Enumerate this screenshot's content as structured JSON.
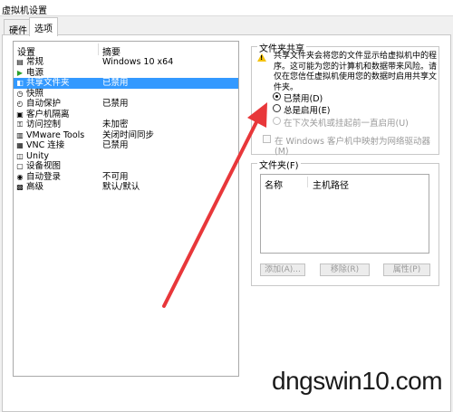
{
  "window": {
    "title": "虚拟机设置"
  },
  "tabs": [
    {
      "label": "硬件"
    },
    {
      "label": "选项"
    }
  ],
  "settings": {
    "col_setting": "设置",
    "col_summary": "摘要",
    "rows": [
      {
        "icon": "general-icon",
        "name": "常规",
        "summary": "Windows 10 x64"
      },
      {
        "icon": "power-icon",
        "name": "电源",
        "summary": ""
      },
      {
        "icon": "shared-folder-icon",
        "name": "共享文件夹",
        "summary": "已禁用"
      },
      {
        "icon": "snapshot-icon",
        "name": "快照",
        "summary": ""
      },
      {
        "icon": "autoprotect-icon",
        "name": "自动保护",
        "summary": "已禁用"
      },
      {
        "icon": "guest-isolation-icon",
        "name": "客户机隔离",
        "summary": ""
      },
      {
        "icon": "access-control-icon",
        "name": "访问控制",
        "summary": "未加密"
      },
      {
        "icon": "vmware-tools-icon",
        "name": "VMware Tools",
        "summary": "关闭时间同步"
      },
      {
        "icon": "vnc-icon",
        "name": "VNC 连接",
        "summary": "已禁用"
      },
      {
        "icon": "unity-icon",
        "name": "Unity",
        "summary": ""
      },
      {
        "icon": "device-view-icon",
        "name": "设备视图",
        "summary": ""
      },
      {
        "icon": "autologin-icon",
        "name": "自动登录",
        "summary": "不可用"
      },
      {
        "icon": "advanced-icon",
        "name": "高级",
        "summary": "默认/默认"
      }
    ]
  },
  "share_group": {
    "title": "文件夹共享",
    "warning": "共享文件夹会将您的文件显示给虚拟机中的程序。这可能为您的计算机和数据带来风险。请仅在您信任虚拟机使用您的数据时启用共享文件夹。",
    "radio_disabled": "已禁用(D)",
    "radio_always": "总是启用(E)",
    "radio_until_off": "在下次关机或挂起前一直启用(U)",
    "map_drive": "在 Windows 客户机中映射为网络驱动器(M)"
  },
  "folder_group": {
    "title": "文件夹(F)",
    "col_name": "名称",
    "col_path": "主机路径",
    "add": "添加(A)...",
    "remove": "移除(R)",
    "properties": "属性(P)"
  },
  "watermark": "dngswin10.com",
  "colors": {
    "selection": "#3399ff",
    "arrow": "#e8373a"
  }
}
